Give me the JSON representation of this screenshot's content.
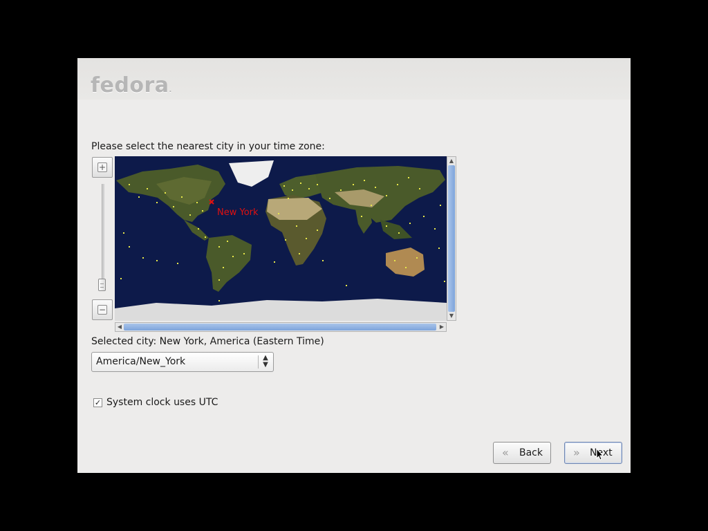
{
  "app": {
    "logo_text": "fedora"
  },
  "timezone": {
    "instruction": "Please select the nearest city in your time zone:",
    "map_city_label": "New York",
    "selected_city_text": "Selected city: New York, America (Eastern Time)",
    "selected_zone": "America/New_York",
    "utc_label": "System clock uses UTC",
    "utc_checked": true
  },
  "zoom": {
    "in_icon": "zoom-in-icon",
    "out_icon": "zoom-out-icon"
  },
  "nav": {
    "back_label": "Back",
    "next_label": "Next"
  },
  "colors": {
    "ocean": "#0d1a4a",
    "city_marker": "#e8e84a",
    "selected_marker": "#e01010",
    "scroll_thumb": "#8fb0e0"
  }
}
